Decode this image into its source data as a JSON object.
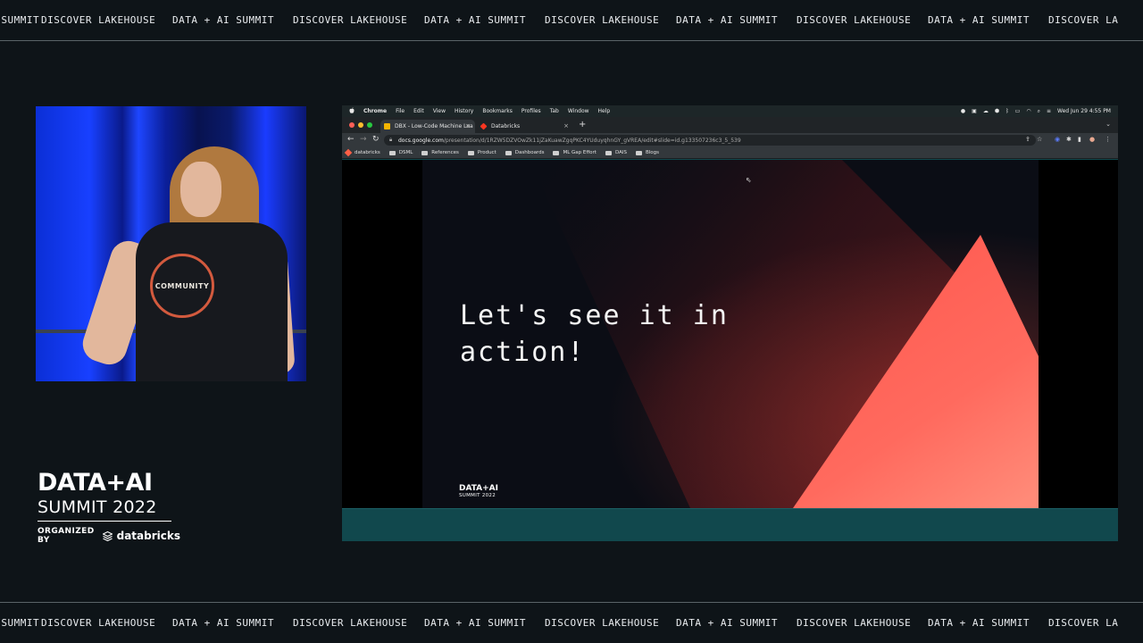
{
  "marquee": {
    "items": [
      "AI SUMMIT",
      "DISCOVER LAKEHOUSE",
      "DATA + AI SUMMIT",
      "DISCOVER LAKEHOUSE",
      "DATA + AI SUMMIT",
      "DISCOVER LAKEHOUSE",
      "DATA + AI SUMMIT",
      "DISCOVER LAKEHOUSE",
      "DATA + AI SUMMIT",
      "DISCOVER LA"
    ]
  },
  "speaker": {
    "shirt_text": "COMMUNITY"
  },
  "summit_logo": {
    "line1": "DATA+AI",
    "line2": "SUMMIT 2022",
    "organized_by": "ORGANIZED BY",
    "brand": "databricks"
  },
  "mac_menubar": {
    "app": "Chrome",
    "items": [
      "File",
      "Edit",
      "View",
      "History",
      "Bookmarks",
      "Profiles",
      "Tab",
      "Window",
      "Help"
    ],
    "datetime": "Wed Jun 29  4:55 PM"
  },
  "browser": {
    "tabs": [
      {
        "title": "DBX - Low-Code Machine Lea",
        "active": true
      },
      {
        "title": "Databricks",
        "active": false
      }
    ],
    "url_host": "docs.google.com",
    "url_path": "/presentation/d/1RZW5DZVOwZk11jZaKuawZgqPKC4YUduyqhnGY_gVREA/edit#slide=id.g133507236c3_5_539",
    "bookmarks": [
      "databricks",
      "DSML",
      "References",
      "Product",
      "Dashboards",
      "ML Gap Effort",
      "DAIS",
      "Blogs"
    ]
  },
  "slide": {
    "title": "Let's see it in\naction!",
    "logo_line1": "DATA+AI",
    "logo_line2": "SUMMIT 2022"
  },
  "colors": {
    "page_bg": "#0e1418",
    "accent_coral": "#ff5f57",
    "stage_blue": "#1840ff",
    "screen_teal": "#11484d"
  }
}
